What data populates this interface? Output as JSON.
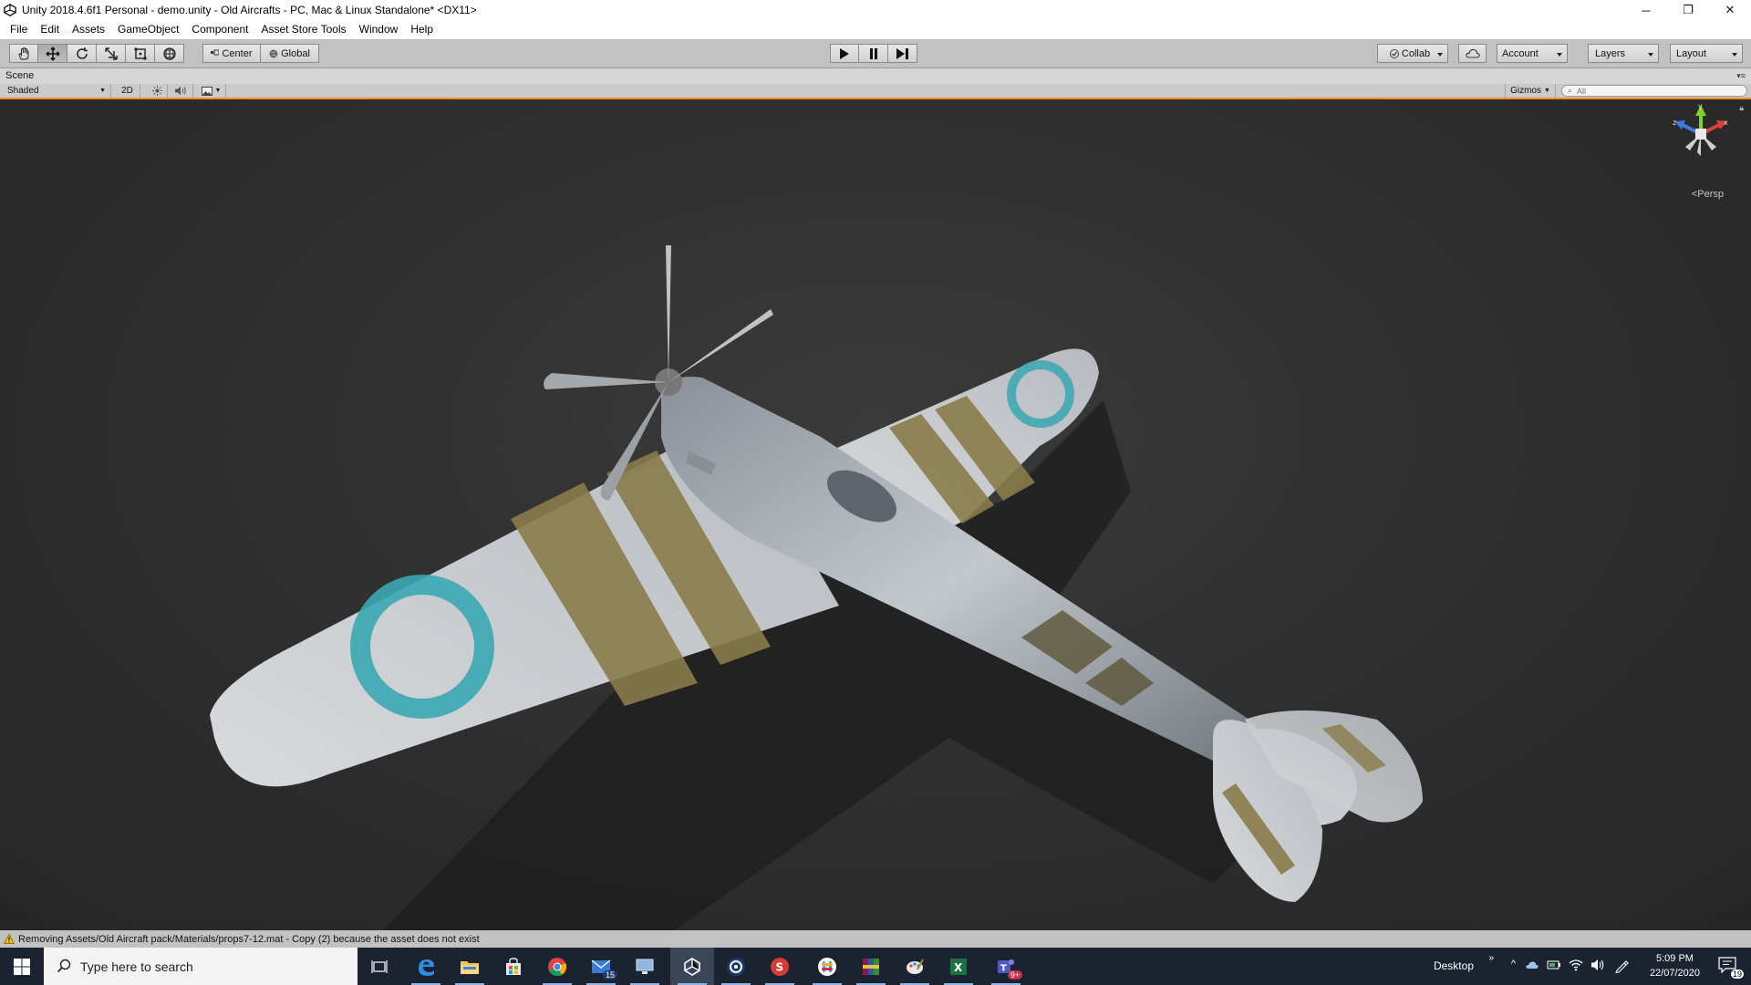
{
  "window": {
    "title": "Unity 2018.4.6f1 Personal - demo.unity - Old Aircrafts - PC, Mac & Linux Standalone* <DX11>",
    "minimize_glyph": "─",
    "restore_glyph": "❐",
    "close_glyph": "✕"
  },
  "menu": {
    "items": [
      "File",
      "Edit",
      "Assets",
      "GameObject",
      "Component",
      "Asset Store Tools",
      "Window",
      "Help"
    ]
  },
  "toolbar": {
    "pivot_label": "Center",
    "space_label": "Global",
    "collab_label": "Collab",
    "account_label": "Account",
    "layers_label": "Layers",
    "layout_label": "Layout"
  },
  "scene": {
    "tab_label": "Scene",
    "shading_mode": "Shaded",
    "mode_2d_label": "2D",
    "gizmos_label": "Gizmos",
    "search_placeholder": "All",
    "projection_label": "Persp",
    "gizmo_axes": {
      "y": "y",
      "x": "x",
      "z": "z"
    }
  },
  "status": {
    "message": "Removing Assets/Old Aircraft pack/Materials/props7-12.mat - Copy (2) because the asset does not exist"
  },
  "taskbar": {
    "search_placeholder": "Type here to search",
    "apps": [
      {
        "name": "task-view",
        "badge": ""
      },
      {
        "name": "edge",
        "badge": ""
      },
      {
        "name": "file-explorer",
        "badge": ""
      },
      {
        "name": "store",
        "badge": ""
      },
      {
        "name": "chrome",
        "badge": ""
      },
      {
        "name": "mail",
        "badge": "15"
      },
      {
        "name": "app-generic",
        "badge": ""
      },
      {
        "name": "unity",
        "badge": ""
      },
      {
        "name": "cinema4d",
        "badge": ""
      },
      {
        "name": "substance",
        "badge": ""
      },
      {
        "name": "slack",
        "badge": ""
      },
      {
        "name": "winrar",
        "badge": ""
      },
      {
        "name": "paint",
        "badge": ""
      },
      {
        "name": "excel",
        "badge": ""
      },
      {
        "name": "teams",
        "badge": "9+"
      }
    ],
    "desktop_label": "Desktop",
    "time": "5:09 PM",
    "date": "22/07/2020",
    "notification_count": "19"
  },
  "colors": {
    "accent_orange": "#f08a2c",
    "roundel_teal": "#3aa7b3",
    "stripe_olive": "#8a7b4a",
    "aircraft_silver": "#c9ccd0"
  }
}
